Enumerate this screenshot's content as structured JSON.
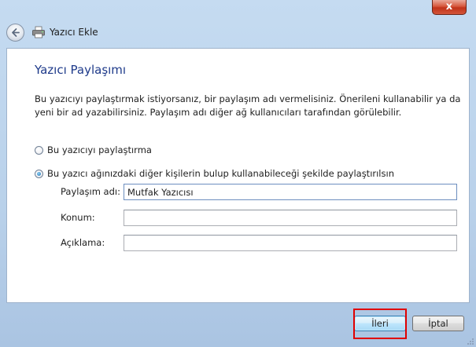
{
  "window": {
    "close_glyph": "x"
  },
  "nav": {
    "title": "Yazıcı Ekle",
    "back_icon": "back-arrow-icon",
    "app_icon": "printer-icon"
  },
  "page": {
    "heading": "Yazıcı Paylaşımı",
    "description": "Bu yazıcıyı paylaştırmak istiyorsanız, bir paylaşım adı vermelisiniz. Önerileni kullanabilir ya da yeni bir ad yazabilirsiniz. Paylaşım adı diğer ağ kullanıcıları tarafından görülebilir."
  },
  "options": {
    "no_share": {
      "label": "Bu yazıcıyı paylaştırma",
      "checked": false
    },
    "share": {
      "label": "Bu yazıcı ağınızdaki diğer kişilerin bulup kullanabileceği şekilde paylaştırılsın",
      "checked": true
    }
  },
  "fields": {
    "share_name": {
      "label": "Paylaşım adı:",
      "value": "Mutfak Yazıcısı"
    },
    "location": {
      "label": "Konum:",
      "value": ""
    },
    "comment": {
      "label": "Açıklama:",
      "value": ""
    }
  },
  "buttons": {
    "next": "İleri",
    "cancel": "İptal"
  },
  "colors": {
    "heading": "#1e3a8a",
    "highlight": "#e00000",
    "close": "#c1331a"
  }
}
